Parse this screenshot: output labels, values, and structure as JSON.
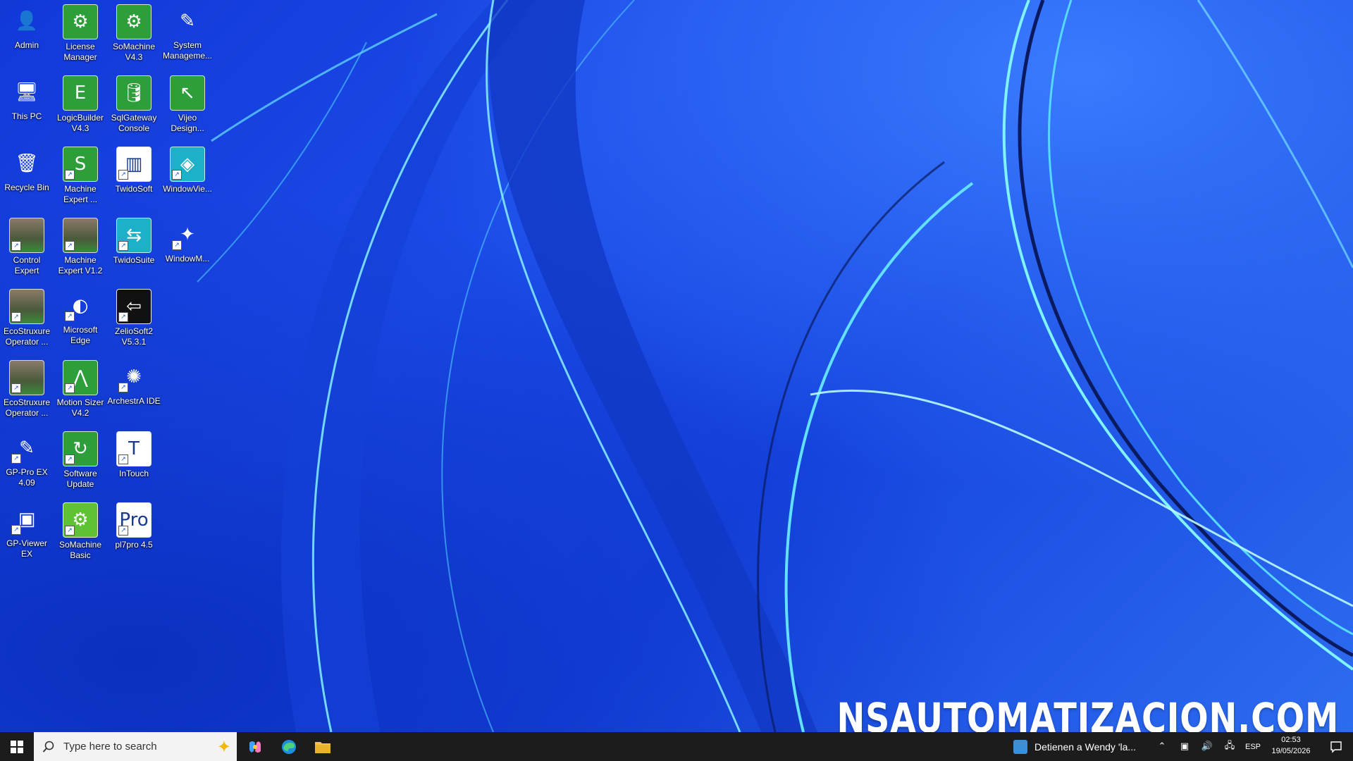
{
  "desktop": {
    "watermark": "NSAUTOMATIZACION.COM",
    "icons": [
      {
        "label": "Admin",
        "icon": "user-folder-icon",
        "glyph": "👤",
        "style": "bg-none"
      },
      {
        "label": "License\nManager",
        "icon": "license-manager-icon",
        "glyph": "⚙",
        "style": "bg-green"
      },
      {
        "label": "SoMachine\nV4.3",
        "icon": "somachine-icon",
        "glyph": "⚙",
        "style": "bg-green"
      },
      {
        "label": "System\nManageme...",
        "icon": "system-management-icon",
        "glyph": "✎",
        "style": "bg-none"
      },
      {
        "label": "This PC",
        "icon": "computer-icon",
        "glyph": "🖥",
        "style": "bg-none"
      },
      {
        "label": "LogicBuilder\nV4.3",
        "icon": "logicbuilder-icon",
        "glyph": "E",
        "style": "bg-green"
      },
      {
        "label": "SqlGateway\nConsole",
        "icon": "database-icon",
        "glyph": "🛢",
        "style": "bg-green"
      },
      {
        "label": "Vijeo\nDesign...",
        "icon": "vijeo-designer-icon",
        "glyph": "↖",
        "style": "bg-green"
      },
      {
        "label": "Recycle Bin",
        "icon": "recycle-bin-icon",
        "glyph": "🗑",
        "style": "bg-none"
      },
      {
        "label": "Machine\nExpert ...",
        "icon": "machine-expert-icon",
        "glyph": "S",
        "style": "bg-green"
      },
      {
        "label": "TwidoSoft",
        "icon": "twidosoft-icon",
        "glyph": "▥",
        "style": "bg-white"
      },
      {
        "label": "WindowVie...",
        "icon": "windowviewer-icon",
        "glyph": "◈",
        "style": "bg-teal"
      },
      {
        "label": "Control\nExpert",
        "icon": "control-expert-icon",
        "glyph": "",
        "style": "bg-photo"
      },
      {
        "label": "Machine\nExpert V1.2",
        "icon": "machine-expert-v12-icon",
        "glyph": "",
        "style": "bg-photo"
      },
      {
        "label": "TwidoSuite",
        "icon": "twidosuite-icon",
        "glyph": "⇆",
        "style": "bg-teal"
      },
      {
        "label": "WindowM...",
        "icon": "windowmaker-icon",
        "glyph": "✦",
        "style": "bg-none"
      },
      {
        "label": "EcoStruxure\nOperator ...",
        "icon": "ecostruxure-operator-icon",
        "glyph": "",
        "style": "bg-photo"
      },
      {
        "label": "Microsoft\nEdge",
        "icon": "edge-icon",
        "glyph": "◐",
        "style": "bg-none"
      },
      {
        "label": "ZelioSoft2\nV5.3.1",
        "icon": "zeliosoft-icon",
        "glyph": "⇦",
        "style": "bg-black"
      },
      null,
      {
        "label": "EcoStruxure\nOperator ...",
        "icon": "ecostruxure-operator-icon",
        "glyph": "",
        "style": "bg-photo"
      },
      {
        "label": "Motion Sizer\nV4.2",
        "icon": "motion-sizer-icon",
        "glyph": "⋀",
        "style": "bg-green"
      },
      {
        "label": "ArchestrA IDE",
        "icon": "archestra-ide-icon",
        "glyph": "✺",
        "style": "bg-none"
      },
      null,
      {
        "label": "GP-Pro EX\n4.09",
        "icon": "gp-pro-ex-icon",
        "glyph": "✎",
        "style": "bg-none"
      },
      {
        "label": "Software\nUpdate",
        "icon": "software-update-icon",
        "glyph": "↻",
        "style": "bg-green"
      },
      {
        "label": "InTouch",
        "icon": "intouch-icon",
        "glyph": "T",
        "style": "bg-white"
      },
      null,
      {
        "label": "GP-Viewer EX",
        "icon": "gp-viewer-ex-icon",
        "glyph": "▣",
        "style": "bg-none"
      },
      {
        "label": "SoMachine\nBasic",
        "icon": "somachine-basic-icon",
        "glyph": "⚙",
        "style": "bg-lime"
      },
      {
        "label": "pl7pro 4.5",
        "icon": "pl7pro-icon",
        "glyph": "Pro",
        "style": "bg-white"
      },
      null
    ]
  },
  "taskbar": {
    "search_placeholder": "Type here to search",
    "news_text": "Detienen a Wendy 'la...",
    "language": "ESP",
    "time": "02:53",
    "date": "19/05/2026"
  }
}
